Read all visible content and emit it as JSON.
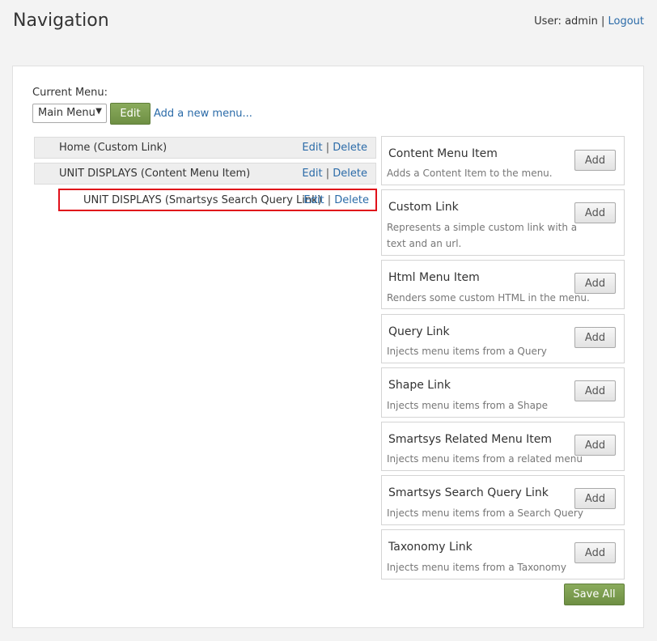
{
  "page": {
    "title": "Navigation"
  },
  "user_bar": {
    "user_text": "User: admin",
    "separator": "|",
    "logout": "Logout"
  },
  "menu_picker": {
    "label": "Current Menu:",
    "selected": "Main Menu",
    "edit_button": "Edit",
    "add_link": "Add a new menu..."
  },
  "tree": {
    "items": [
      {
        "label": "Home (Custom Link)",
        "edit": "Edit",
        "sep": "|",
        "delete": "Delete"
      },
      {
        "label": "UNIT DISPLAYS (Content Menu Item)",
        "edit": "Edit",
        "sep": "|",
        "delete": "Delete"
      },
      {
        "label": "UNIT DISPLAYS (Smartsys Search Query Link)",
        "edit": "Edit",
        "sep": "|",
        "delete": "Delete"
      }
    ]
  },
  "types": [
    {
      "title": "Content Menu Item",
      "desc": "Adds a Content Item to the menu.",
      "add": "Add"
    },
    {
      "title": "Custom Link",
      "desc": "Represents a simple custom link with a text and an url.",
      "add": "Add"
    },
    {
      "title": "Html Menu Item",
      "desc": "Renders some custom HTML in the menu.",
      "add": "Add"
    },
    {
      "title": "Query Link",
      "desc": "Injects menu items from a Query",
      "add": "Add"
    },
    {
      "title": "Shape Link",
      "desc": "Injects menu items from a Shape",
      "add": "Add"
    },
    {
      "title": "Smartsys Related Menu Item",
      "desc": "Injects menu items from a related menu",
      "add": "Add"
    },
    {
      "title": "Smartsys Search Query Link",
      "desc": "Injects menu items from a Search Query",
      "add": "Add"
    },
    {
      "title": "Taxonomy Link",
      "desc": "Injects menu items from a Taxonomy",
      "add": "Add"
    }
  ],
  "save_all": "Save All",
  "colors": {
    "accent_green": "#7a9a4c",
    "link_blue": "#2b6ba8",
    "highlight_red": "#e0101a"
  }
}
